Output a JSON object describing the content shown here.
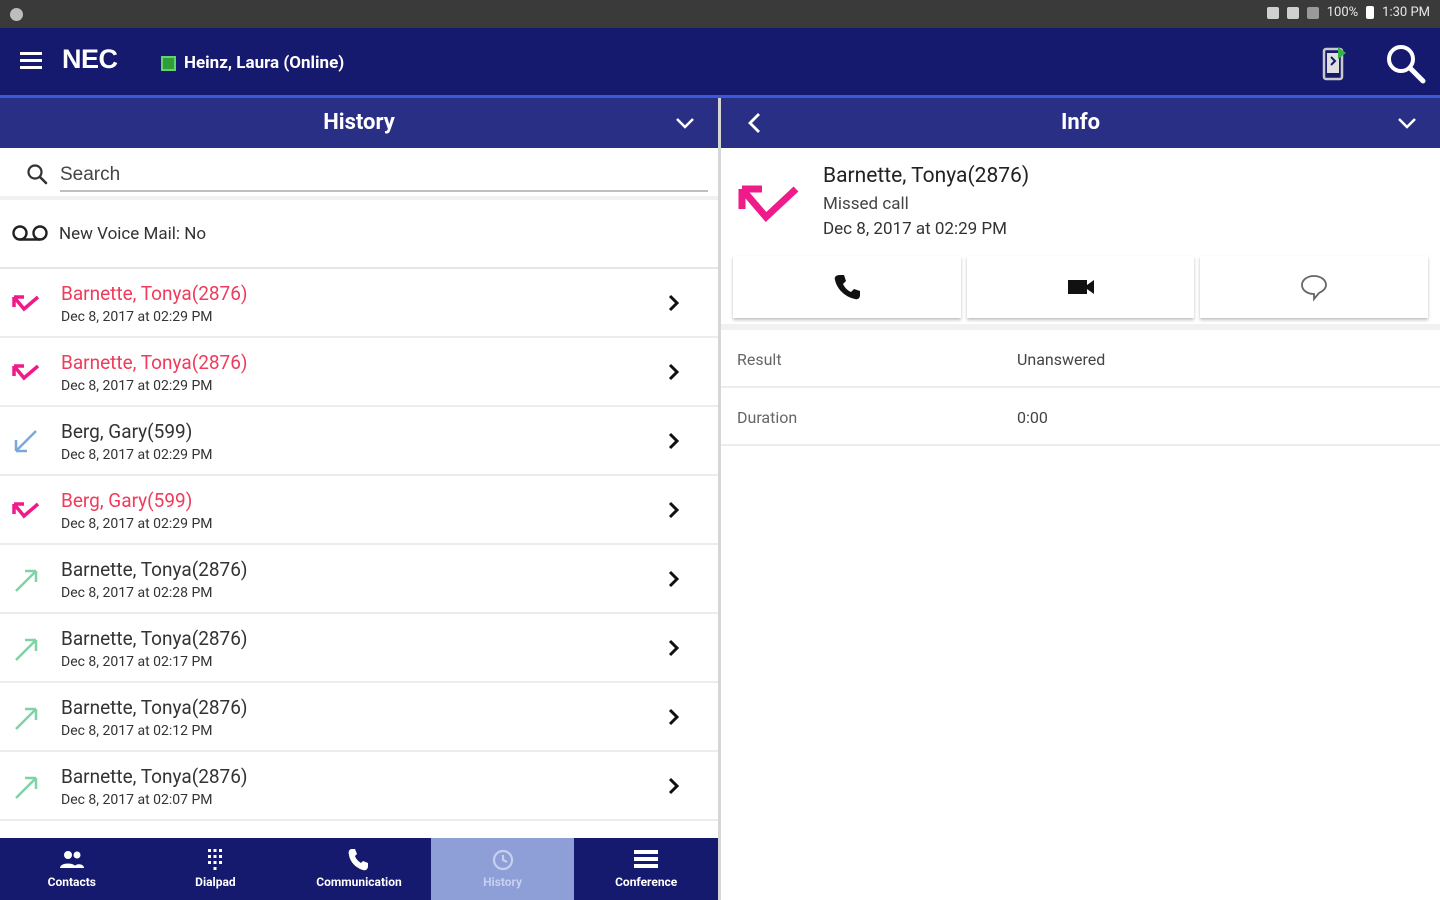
{
  "status_bar": {
    "battery": "100%",
    "time": "1:30 PM"
  },
  "app_bar": {
    "brand": "NEC",
    "user_presence": "Heinz, Laura (Online)",
    "presence_color": "#2f9e3a"
  },
  "history_pane": {
    "title": "History",
    "search_placeholder": "Search",
    "voicemail": "New Voice Mail: No",
    "rows": [
      {
        "name": "Barnette, Tonya(2876)",
        "date": "Dec 8, 2017 at 02:29 PM",
        "type": "missed"
      },
      {
        "name": "Barnette, Tonya(2876)",
        "date": "Dec 8, 2017 at 02:29 PM",
        "type": "missed"
      },
      {
        "name": "Berg, Gary(599)",
        "date": "Dec 8, 2017 at 02:29 PM",
        "type": "incoming"
      },
      {
        "name": "Berg, Gary(599)",
        "date": "Dec 8, 2017 at 02:29 PM",
        "type": "missed"
      },
      {
        "name": "Barnette, Tonya(2876)",
        "date": "Dec 8, 2017 at 02:28 PM",
        "type": "outgoing"
      },
      {
        "name": "Barnette, Tonya(2876)",
        "date": "Dec 8, 2017 at 02:17 PM",
        "type": "outgoing"
      },
      {
        "name": "Barnette, Tonya(2876)",
        "date": "Dec 8, 2017 at 02:12 PM",
        "type": "outgoing"
      },
      {
        "name": "Barnette, Tonya(2876)",
        "date": "Dec 8, 2017 at 02:07 PM",
        "type": "outgoing"
      }
    ]
  },
  "bottom_nav": {
    "items": [
      {
        "label": "Contacts",
        "icon": "people-icon"
      },
      {
        "label": "Dialpad",
        "icon": "dialpad-icon"
      },
      {
        "label": "Communication",
        "icon": "phone-icon"
      },
      {
        "label": "History",
        "icon": "history-icon",
        "active": true
      },
      {
        "label": "Conference",
        "icon": "conference-icon"
      }
    ]
  },
  "info_pane": {
    "title": "Info",
    "contact_name": "Barnette, Tonya(2876)",
    "call_status": "Missed call",
    "call_date": "Dec 8, 2017 at 02:29 PM",
    "details": [
      {
        "label": "Result",
        "value": "Unanswered"
      },
      {
        "label": "Duration",
        "value": "0:00"
      }
    ]
  },
  "colors": {
    "app_bar": "#161a6e",
    "pane_header": "#2a2f86",
    "missed": "#ef3b5c",
    "incoming": "#7aa7e0",
    "outgoing": "#7fd3a6",
    "nav_active": "#8e9ed6"
  }
}
